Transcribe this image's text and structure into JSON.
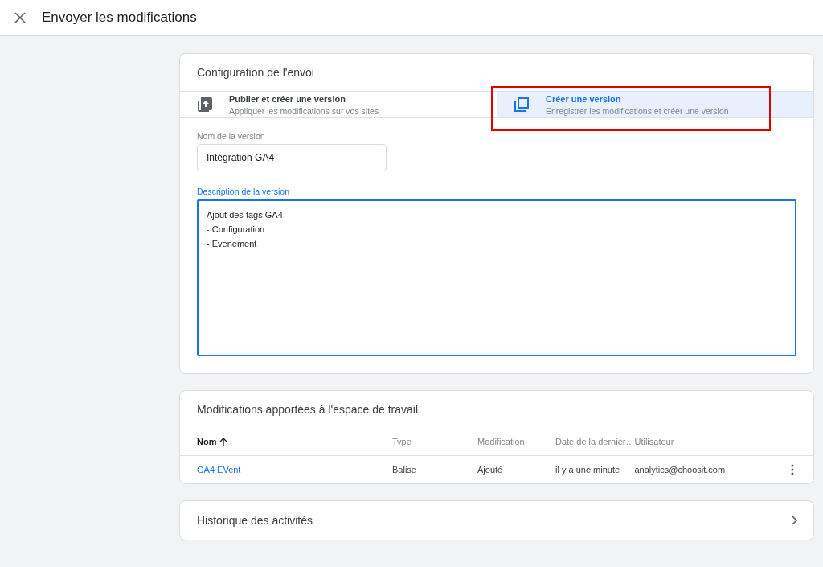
{
  "header": {
    "title": "Envoyer les modifications"
  },
  "submission": {
    "title": "Configuration de l'envoi",
    "options": [
      {
        "kind": "publish",
        "title": "Publier et créer une version",
        "subtitle": "Appliquer les modifications sur vos sites",
        "selected": false
      },
      {
        "kind": "version",
        "title": "Créer une version",
        "subtitle": "Enregistrer les modifications et créer une version",
        "selected": true,
        "highlighted": true
      }
    ],
    "version_name": {
      "label": "Nom de la version",
      "value": "Intégration GA4"
    },
    "version_description": {
      "label": "Description de la version",
      "value": "Ajout des tags GA4\n- Configuration\n- Evenement",
      "focused": true
    }
  },
  "changes": {
    "title": "Modifications apportées à l'espace de travail",
    "columns": [
      {
        "label": "Nom",
        "sorted": true
      },
      {
        "label": "Type",
        "sorted": false
      },
      {
        "label": "Modification",
        "sorted": false
      },
      {
        "label": "Date de la dernièr…",
        "sorted": false
      },
      {
        "label": "Utilisateur",
        "sorted": false
      }
    ],
    "rows": [
      {
        "name": "GA4 EVent",
        "type": "Balise",
        "change": "Ajouté",
        "date": "il y a une minute",
        "user": "analytics@choosit.com"
      }
    ]
  },
  "history": {
    "title": "Historique des activités"
  }
}
